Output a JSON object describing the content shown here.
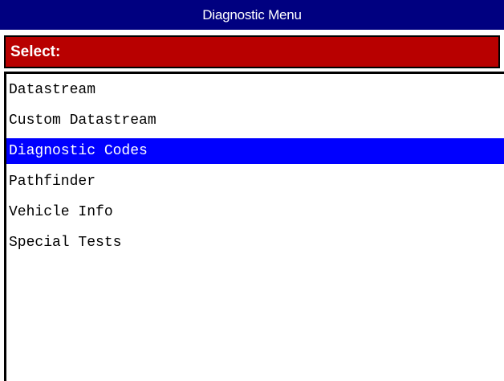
{
  "window": {
    "title": "Diagnostic Menu"
  },
  "header": {
    "label": "Select:"
  },
  "menu": {
    "items": [
      {
        "label": "Datastream",
        "selected": false
      },
      {
        "label": "Custom Datastream",
        "selected": false
      },
      {
        "label": "Diagnostic Codes",
        "selected": true
      },
      {
        "label": "Pathfinder",
        "selected": false
      },
      {
        "label": "Vehicle Info",
        "selected": false
      },
      {
        "label": "Special Tests",
        "selected": false
      }
    ]
  },
  "colors": {
    "title_bar": "#000080",
    "header_bar": "#b80000",
    "selection": "#0000ff"
  }
}
